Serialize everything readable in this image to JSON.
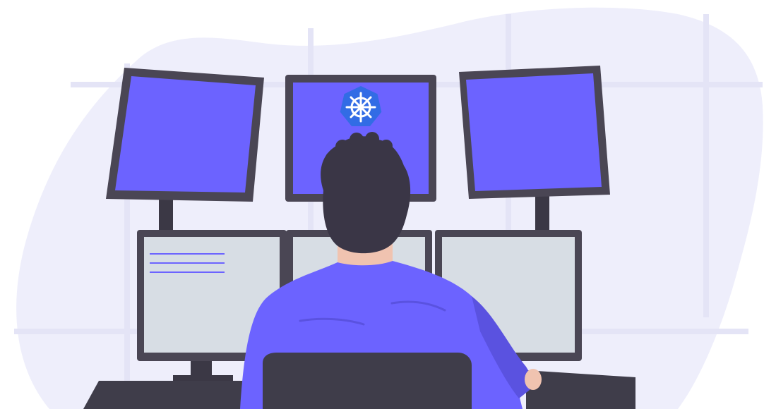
{
  "illustration": {
    "subject": "person-at-monitor-workstation",
    "icon": "kubernetes-helm-wheel-icon",
    "colors": {
      "blob_background": "#EEEEFB",
      "window_grid": "#E4E4F6",
      "monitor_frame": "#4A4654",
      "monitor_stand": "#3B3845",
      "screen_accent": "#6C63FF",
      "screen_light": "#D7DDE4",
      "screen_lines": "#6C63FF",
      "kubernetes_blue": "#326CE5",
      "hair": "#3A3646",
      "skin": "#F0C3B0",
      "shirt": "#6C63FF",
      "shirt_shadow": "#5A52E0",
      "chair": "#3F3D4A",
      "desk": "#3F3D4A"
    }
  }
}
